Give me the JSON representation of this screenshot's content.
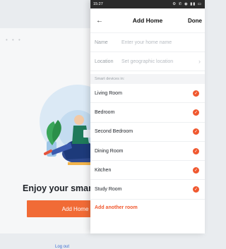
{
  "background_screen": {
    "headline": "Enjoy your smart l",
    "primary_button": "Add Home",
    "logout_link": "Log out"
  },
  "add_home_screen": {
    "status_time": "15:27",
    "nav": {
      "back_icon": "arrow-left-icon",
      "title": "Add Home",
      "done": "Done"
    },
    "fields": {
      "name_label": "Name",
      "name_placeholder": "Enter your home name",
      "location_label": "Location",
      "location_placeholder": "Set geographic location"
    },
    "section_title": "Smart devices in:",
    "rooms": [
      {
        "label": "Living Room",
        "checked": true
      },
      {
        "label": "Bedroom",
        "checked": true
      },
      {
        "label": "Second Bedroom",
        "checked": true
      },
      {
        "label": "Dining Room",
        "checked": true
      },
      {
        "label": "Kitchen",
        "checked": true
      },
      {
        "label": "Study Room",
        "checked": true
      }
    ],
    "add_another": "Add another room"
  },
  "colors": {
    "accent": "#f16b36",
    "check": "#f0582f",
    "link": "#3c6fd1"
  }
}
